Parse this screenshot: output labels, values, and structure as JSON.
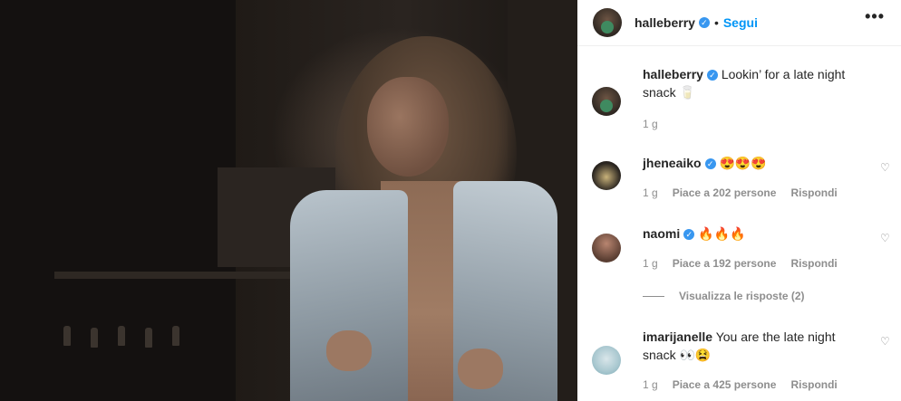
{
  "post": {
    "author": "halleberry",
    "follow_label": "Segui",
    "separator": "•",
    "more_icon": "more-horizontal-icon",
    "caption": {
      "author": "halleberry",
      "text": "Lookin’ for a late night snack 🥛",
      "age": "1 g"
    }
  },
  "comments": [
    {
      "author": "jheneaiko",
      "text": "😍😍😍",
      "age": "1 g",
      "likes": "Piace a 202 persone",
      "reply": "Rispondi",
      "verified": true
    },
    {
      "author": "naomi",
      "text": "🔥🔥🔥",
      "age": "1 g",
      "likes": "Piace a 192 persone",
      "reply": "Rispondi",
      "verified": true
    },
    {
      "author": "imarijanelle",
      "text": "You are the late night snack 👀😫",
      "age": "1 g",
      "likes": "Piace a 425 persone",
      "reply": "Rispondi",
      "verified": false
    }
  ],
  "view_replies": "Visualizza le risposte (2)",
  "colors": {
    "accent": "#0095f6",
    "verified": "#3897f0",
    "muted": "#8e8e8e"
  }
}
